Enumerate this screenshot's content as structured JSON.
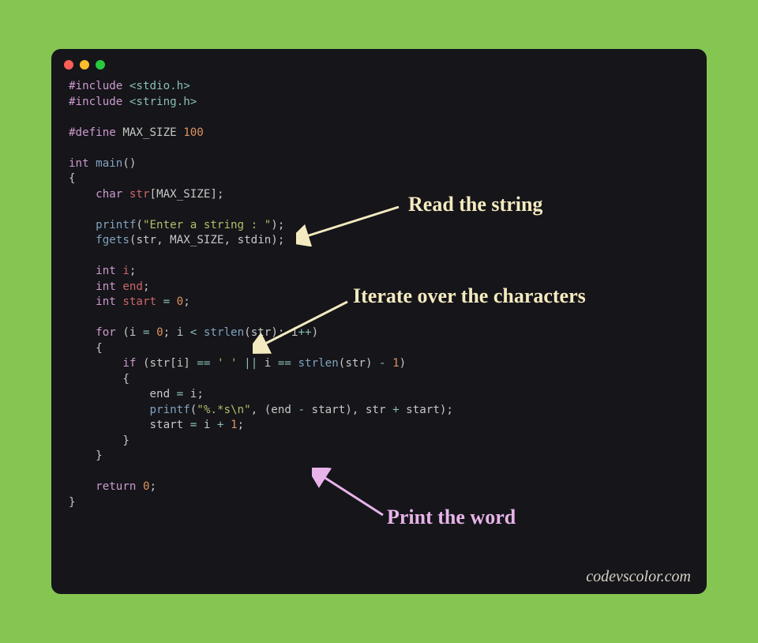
{
  "annotations": {
    "read_string": "Read the string",
    "iterate_chars": "Iterate over the characters",
    "print_word": "Print the word"
  },
  "watermark": "codevscolor.com",
  "code": {
    "include1_kw": "#include",
    "include1_hdr": " <stdio.h>",
    "include2_kw": "#include",
    "include2_hdr": " <string.h>",
    "define_kw": "#define",
    "define_name": " MAX_SIZE ",
    "define_val": "100",
    "int_t": "int",
    "main_fn": " main",
    "lparen": "(",
    "rparen": ")",
    "lbrace": "{",
    "rbrace": "}",
    "char_t": "char",
    "str_var": " str",
    "lbracket": "[",
    "maxsize": "MAX_SIZE",
    "rbracket": "]",
    "semi": ";",
    "printf_fn": "printf",
    "printf_arg": "\"Enter a string : \"",
    "fgets_fn": "fgets",
    "fgets_a1": "str",
    "fgets_a2": " MAX_SIZE",
    "fgets_a3": " stdin",
    "comma": ",",
    "i_var": " i",
    "end_var": " end",
    "start_var": " start ",
    "eq": "=",
    "zero": " 0",
    "for_kw": "for",
    "for_init_i": "i ",
    "for_init_v": " 0",
    "for_cond_i": " i ",
    "lt": "<",
    "strlen_fn": " strlen",
    "strlen_arg": "str",
    "for_inc": " i",
    "pp": "++",
    "if_kw": "if",
    "if_stri": "str",
    "if_i": "i",
    "eqeq": "==",
    "space_ch": " ' '",
    "oror": " || ",
    "if_i2": "i ",
    "strlen2_arg": "str",
    "minus": " - ",
    "one": "1",
    "end_assign": "end ",
    "end_val": " i",
    "printf2_fmt": "\"%.*s\\n\"",
    "printf2_e1": "end ",
    "printf2_e2": " start",
    "printf2_e3": " str ",
    "plus": "+",
    "printf2_e4": " start",
    "start_assign": "start ",
    "start_v1": " i ",
    "start_v2": " 1",
    "return_kw": "return",
    "return_val": " 0"
  }
}
